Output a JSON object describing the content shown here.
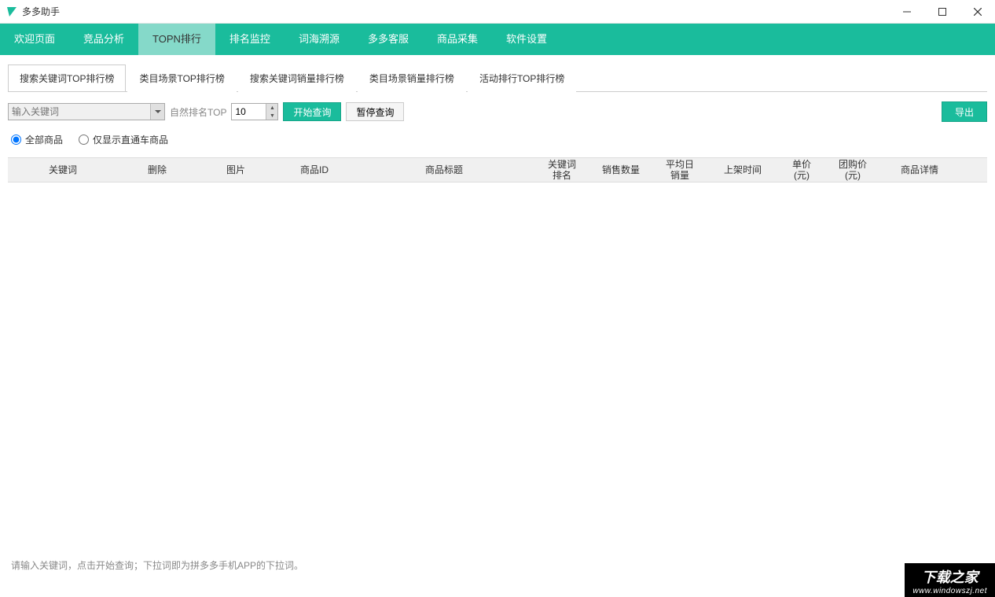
{
  "app": {
    "title": "多多助手"
  },
  "mainnav": {
    "items": [
      {
        "label": "欢迎页面"
      },
      {
        "label": "竞品分析"
      },
      {
        "label": "TOPN排行",
        "active": true
      },
      {
        "label": "排名监控"
      },
      {
        "label": "词海溯源"
      },
      {
        "label": "多多客服"
      },
      {
        "label": "商品采集"
      },
      {
        "label": "软件设置"
      }
    ]
  },
  "subtabs": {
    "items": [
      {
        "label": "搜索关键词TOP排行榜",
        "active": true
      },
      {
        "label": "类目场景TOP排行榜"
      },
      {
        "label": "搜索关键词销量排行榜"
      },
      {
        "label": "类目场景销量排行榜"
      },
      {
        "label": "活动排行TOP排行榜"
      }
    ]
  },
  "toolbar": {
    "keyword_placeholder": "输入关键词",
    "rank_label": "自然排名TOP",
    "rank_value": "10",
    "start_label": "开始查询",
    "pause_label": "暂停查询",
    "export_label": "导出"
  },
  "filters": {
    "all_label": "全部商品",
    "direct_label": "仅显示直通车商品",
    "selected": "all"
  },
  "table": {
    "columns": [
      "关键词",
      "删除",
      "图片",
      "商品ID",
      "商品标题",
      "关键词\n排名",
      "销售数量",
      "平均日\n销量",
      "上架时间",
      "单价\n(元)",
      "团购价\n(元)",
      "商品详情"
    ]
  },
  "status": {
    "hint": "请输入关键词，点击开始查询；下拉词即为拼多多手机APP的下拉词。"
  },
  "watermark": {
    "line1": "下载之家",
    "line2": "www.windowszj.net"
  }
}
